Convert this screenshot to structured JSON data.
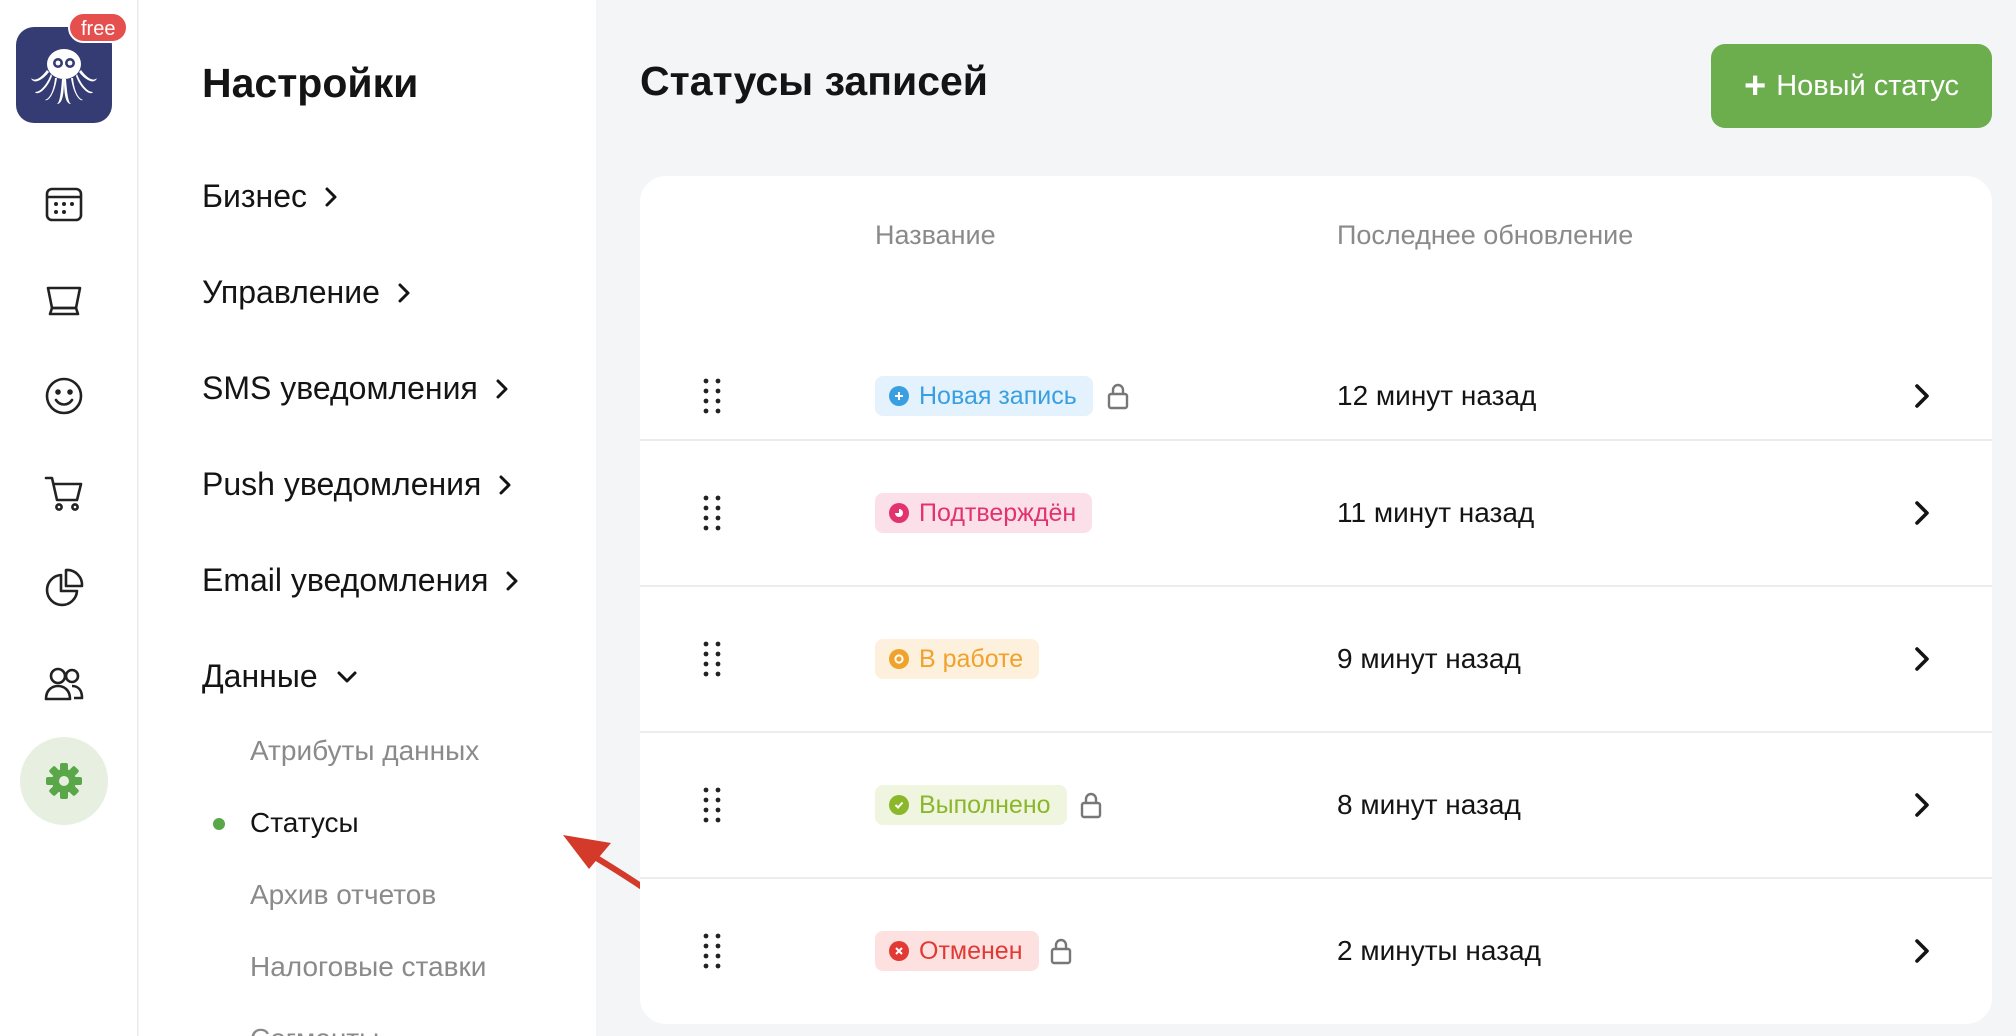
{
  "app": {
    "badge": "free",
    "colors": {
      "accent": "#6cae4e",
      "logo_bg": "#353c73",
      "badge": "#e5504f"
    }
  },
  "rail": {
    "icons": [
      "calendar-icon",
      "box-icon",
      "smile-icon",
      "cart-icon",
      "pie-chart-icon",
      "users-icon",
      "gear-icon"
    ]
  },
  "settings": {
    "title": "Настройки",
    "items": [
      {
        "label": "Бизнес"
      },
      {
        "label": "Управление"
      },
      {
        "label": "SMS уведомления"
      },
      {
        "label": "Push уведомления"
      },
      {
        "label": "Email уведомления"
      },
      {
        "label": "Данные"
      }
    ],
    "subitems": [
      {
        "label": "Атрибуты данных"
      },
      {
        "label": "Статусы"
      },
      {
        "label": "Архив отчетов"
      },
      {
        "label": "Налоговые ставки"
      },
      {
        "label": "Сегменты"
      }
    ]
  },
  "main": {
    "title": "Статусы записей",
    "new_button": "Новый статус",
    "columns": {
      "name": "Название",
      "updated": "Последнее обновление"
    },
    "rows": [
      {
        "status": "Новая запись",
        "updated": "12 минут назад",
        "color": "#3a9fe0",
        "bg": "#e3f2fc",
        "locked": true
      },
      {
        "status": "Подтверждён",
        "updated": "11 минут назад",
        "color": "#e2336e",
        "bg": "#fbe0ea",
        "locked": false
      },
      {
        "status": "В работе",
        "updated": "9 минут назад",
        "color": "#f0a22b",
        "bg": "#fdf0dc",
        "locked": false
      },
      {
        "status": "Выполнено",
        "updated": "8 минут назад",
        "color": "#8bb72b",
        "bg": "#eff5df",
        "locked": true
      },
      {
        "status": "Отменен",
        "updated": "2 минуты назад",
        "color": "#e13a34",
        "bg": "#fce1e0",
        "locked": true
      }
    ]
  }
}
